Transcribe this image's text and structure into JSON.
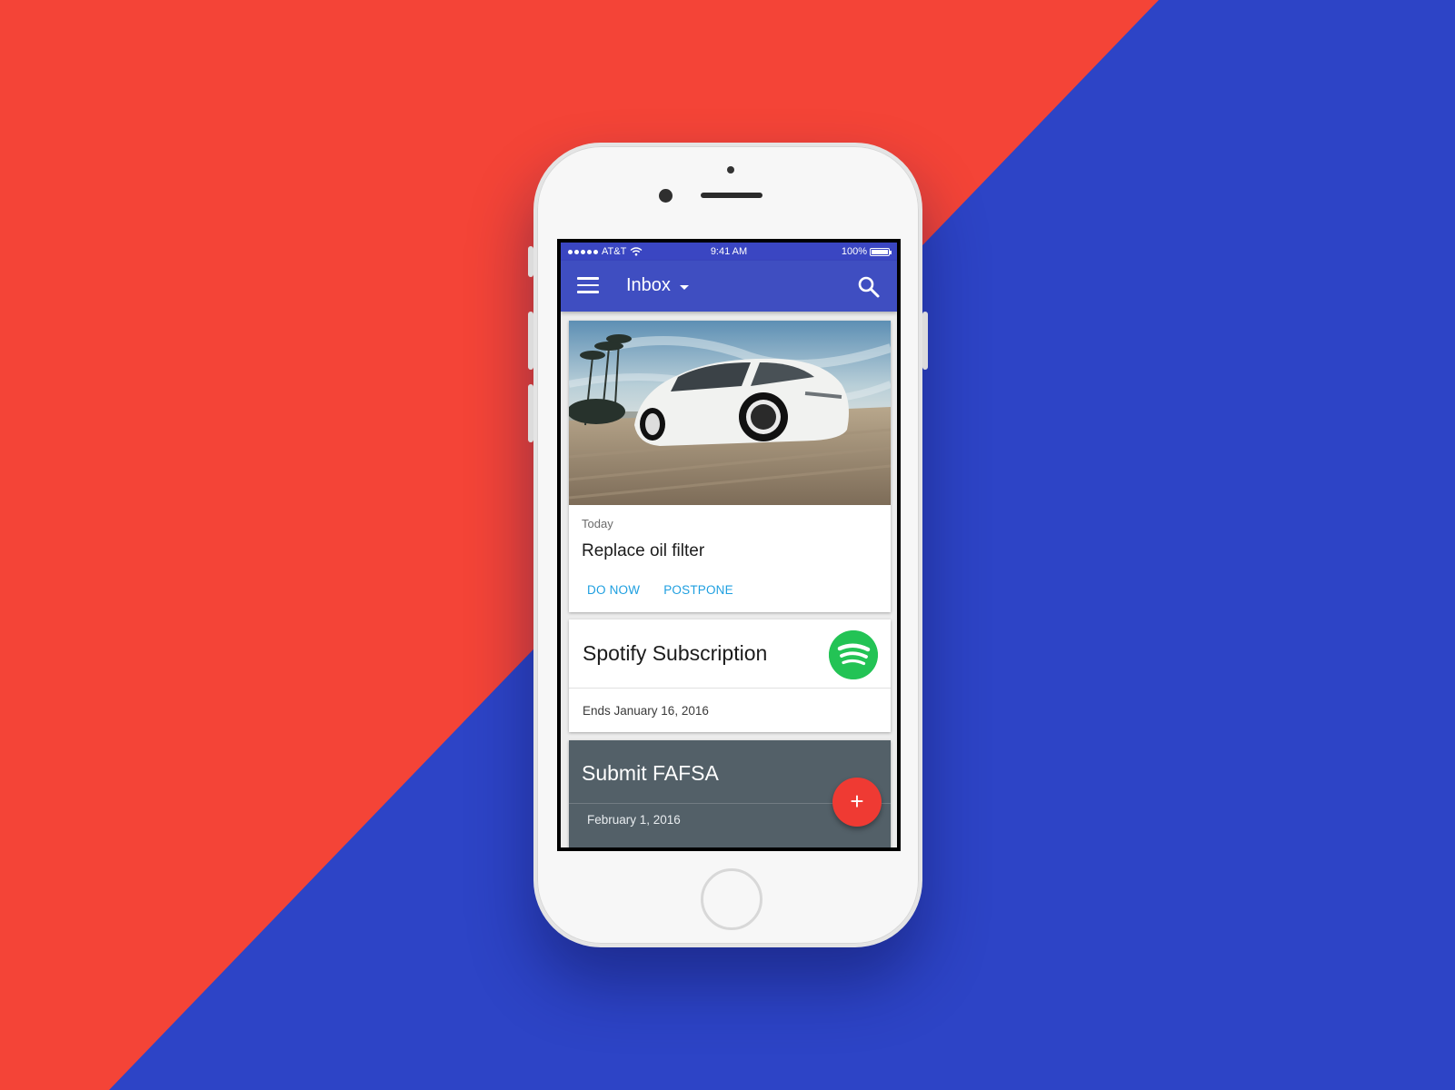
{
  "colors": {
    "red_bg": "#f44437",
    "blue_bg": "#2d44c6",
    "appbar": "#3f4ec1",
    "accent": "#1e9fe0",
    "fab": "#ef3a33",
    "spotify": "#23c355",
    "card3": "#536068"
  },
  "status_bar": {
    "carrier": "AT&T",
    "time": "9:41 AM",
    "battery": "100%",
    "battery_level": 1.0
  },
  "app_bar": {
    "title": "Inbox",
    "menu_icon": "hamburger-menu-icon",
    "dropdown_icon": "caret-down-icon",
    "search_icon": "search-icon"
  },
  "cards": [
    {
      "type": "reminder-with-photo",
      "image": "white sports car on a road with palm trees",
      "date_label": "Today",
      "title": "Replace oil filter",
      "actions": [
        "DO NOW",
        "POSTPONE"
      ]
    },
    {
      "type": "subscription",
      "title": "Spotify Subscription",
      "icon": "spotify-icon",
      "subtitle": "Ends January 16, 2016"
    },
    {
      "type": "task",
      "title": "Submit FAFSA",
      "subtitle": "February 1, 2016"
    }
  ],
  "fab": {
    "label": "+",
    "icon": "plus-icon"
  }
}
